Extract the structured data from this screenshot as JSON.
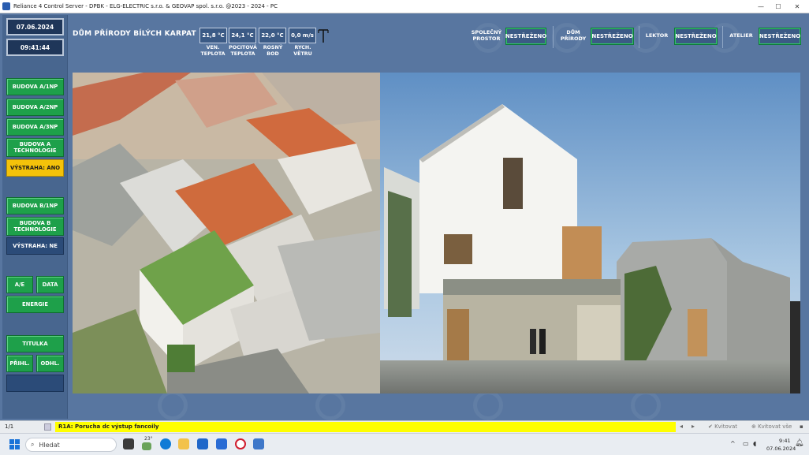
{
  "window": {
    "title": "Reliance 4 Control Server - DPBK - ELG-ELECTRIC s.r.o. & GEOVAP spol. s.r.o. @2023 - 2024 - PC"
  },
  "clock": {
    "date": "07.06.2024",
    "time": "09:41:44"
  },
  "nav": {
    "budova_a_1np": "BUDOVA A/1NP",
    "budova_a_2np": "BUDOVA A/2NP",
    "budova_a_3np": "BUDOVA A/3NP",
    "budova_a_tech_line1": "BUDOVA A",
    "budova_a_tech_line2": "TECHNOLOGIE",
    "vystraha_a": "VÝSTRAHA: ANO",
    "budova_b_1np": "BUDOVA B/1NP",
    "budova_b_tech_line1": "BUDOVA B",
    "budova_b_tech_line2": "TECHNOLOGIE",
    "vystraha_b": "VÝSTRAHA: NE",
    "ae": "A/E",
    "data": "DATA",
    "energie": "ENERGIE",
    "titulka": "TITULKA",
    "prihl": "PŘIHL.",
    "odhl": "ODHL."
  },
  "header": {
    "title": "DŮM PŘÍRODY BÍLÝCH KARPAT",
    "weather": [
      {
        "value": "21,8 °C",
        "label1": "VEN.",
        "label2": "TEPLOTA"
      },
      {
        "value": "24,1 °C",
        "label1": "POCITOVÁ",
        "label2": "TEPLOTA"
      },
      {
        "value": "22,0 °C",
        "label1": "ROSNÝ",
        "label2": "BOD"
      },
      {
        "value": "0,0 m/s",
        "label1": "RYCH.",
        "label2": "VĚTRU"
      }
    ],
    "zones": [
      {
        "label1": "SPOLEČNÝ",
        "label2": "PROSTOR",
        "status": "NESTŘEŽENO"
      },
      {
        "label1": "DŮM",
        "label2": "PŘÍRODY",
        "status": "NESTŘEŽENO"
      },
      {
        "label1": "LEKTOR",
        "label2": "",
        "status": "NESTŘEŽENO"
      },
      {
        "label1": "ATELIER",
        "label2": "",
        "status": "NESTŘEŽENO"
      }
    ]
  },
  "statusbar": {
    "page": "1/1",
    "alarm": "R1A: Porucha dc výstup fancoily",
    "ack": "Kvitovat",
    "ack_all": "Kvitovat vše"
  },
  "taskbar": {
    "search_placeholder": "Hledat",
    "weather_temp": "23°",
    "time": "9:41",
    "date": "07.06.2024"
  },
  "colors": {
    "background": "#5876a0",
    "button_green": "#1ea04a",
    "warning_yellow": "#f4c20a",
    "alarm_bar": "#ffff00"
  }
}
